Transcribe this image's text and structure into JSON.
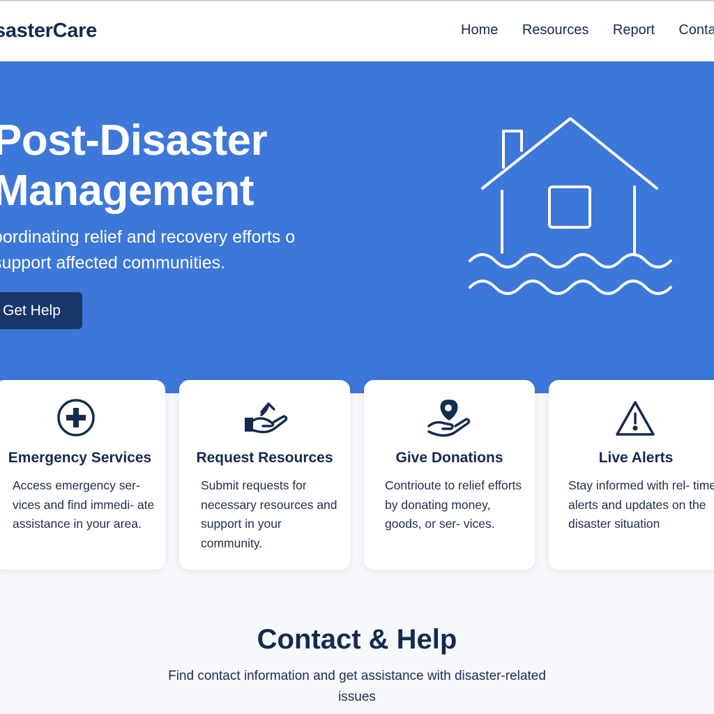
{
  "header": {
    "logo": "sasterCare",
    "nav": [
      {
        "label": "Home"
      },
      {
        "label": "Resources"
      },
      {
        "label": "Report"
      },
      {
        "label": "Conta"
      }
    ]
  },
  "hero": {
    "title": "Post-Disaster Management",
    "subtitle": "oordinating relief and recovery efforts o support affected communities.",
    "cta_label": "Get Help",
    "illustration_icon": "flooded-house-icon"
  },
  "cards": [
    {
      "icon": "medical-cross-icon",
      "title": "Emergency Services",
      "description": "Access emergency ser- vices and find immedi- ate assistance in your area."
    },
    {
      "icon": "hand-receive-icon",
      "title": "Request Resources",
      "description": "Submit requests for necessary resources and support in your community."
    },
    {
      "icon": "heart-hand-icon",
      "title": "Give Donations",
      "description": "Contrioute to relief efforts by donating money, goods, or ser- vices."
    },
    {
      "icon": "warning-triangle-icon",
      "title": "Live Alerts",
      "description": "Stay informed with rel- time alerts and updates on the disaster situation"
    }
  ],
  "contact": {
    "title": "Contact & Help",
    "text": "Find contact information and get assistance with disaster-related issues"
  },
  "colors": {
    "hero_bg": "#3d77d9",
    "accent_dark": "#183769",
    "text_dark": "#152a4f",
    "page_bg": "#f7f8fb"
  }
}
